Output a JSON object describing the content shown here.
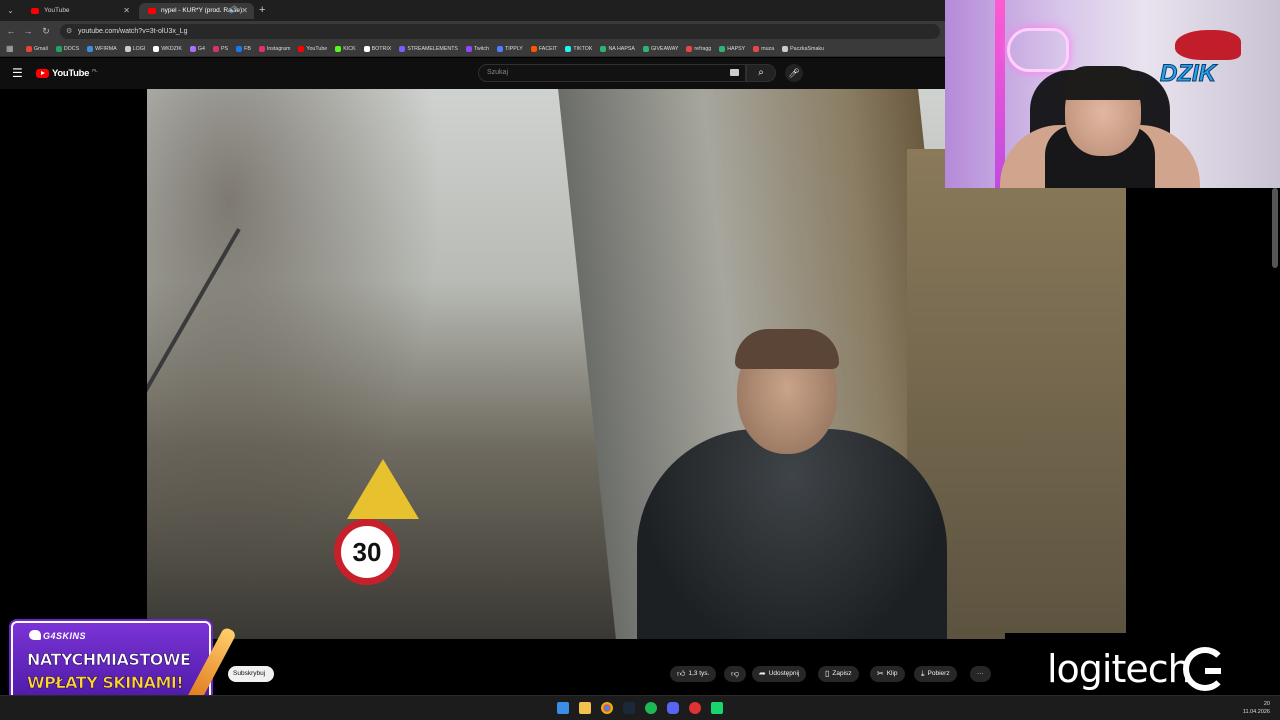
{
  "browser": {
    "tabs": [
      {
        "title": "YouTube",
        "active": false
      },
      {
        "title": "nypel - KUR*Y (prod. Raise)",
        "active": true
      }
    ],
    "url": "youtube.com/watch?v=3t-olU3x_Lg",
    "bookmarks": [
      "Gmail",
      "DOCS",
      "WFIRMA",
      "LOGI",
      "WKDZIK",
      "G4",
      "PS",
      "FB",
      "Instagram",
      "YouTube",
      "KICK",
      "BOTRIX",
      "STREAMELEMENTS",
      "Twitch",
      "TIPPLY",
      "FACEIT",
      "TIKTOK",
      "NA HAPSA",
      "GIVEAWAY",
      "refragg",
      "HAPSY",
      "muza",
      "PaczkaSmaku"
    ],
    "bookmark_colors": [
      "#ea4335",
      "#1fa463",
      "#3d8ee0",
      "#cccccc",
      "#ffffff",
      "#a970ff",
      "#d6336c",
      "#1877f2",
      "#e1306c",
      "#ff0000",
      "#53fc18",
      "#ffffff",
      "#7f5cff",
      "#9146ff",
      "#4f7dff",
      "#ff5500",
      "#25f4ee",
      "#2bb673",
      "#2bb673",
      "#e84545",
      "#2bb673",
      "#e84545",
      "#cccccc"
    ]
  },
  "youtube": {
    "logo_text": "YouTube",
    "region": "PL",
    "search_placeholder": "Szukaj",
    "channel_partial": "s)",
    "subscribe_label": "Subskrybuj",
    "actions": {
      "like_count": "1,3 tys.",
      "share": "Udostępnij",
      "save": "Zapisz",
      "clip": "Klip",
      "download": "Pobierz",
      "more": "···"
    }
  },
  "overlay": {
    "promo_brand": "G4SKINS",
    "promo_line1": "NATYCHMIASTOWE",
    "promo_line2": "WPŁATY SKINAMI!",
    "sponsor_logo": "logitech",
    "cam_logo": "DZIK"
  },
  "taskbar": {
    "time": "20",
    "date": "11.04.2026"
  }
}
